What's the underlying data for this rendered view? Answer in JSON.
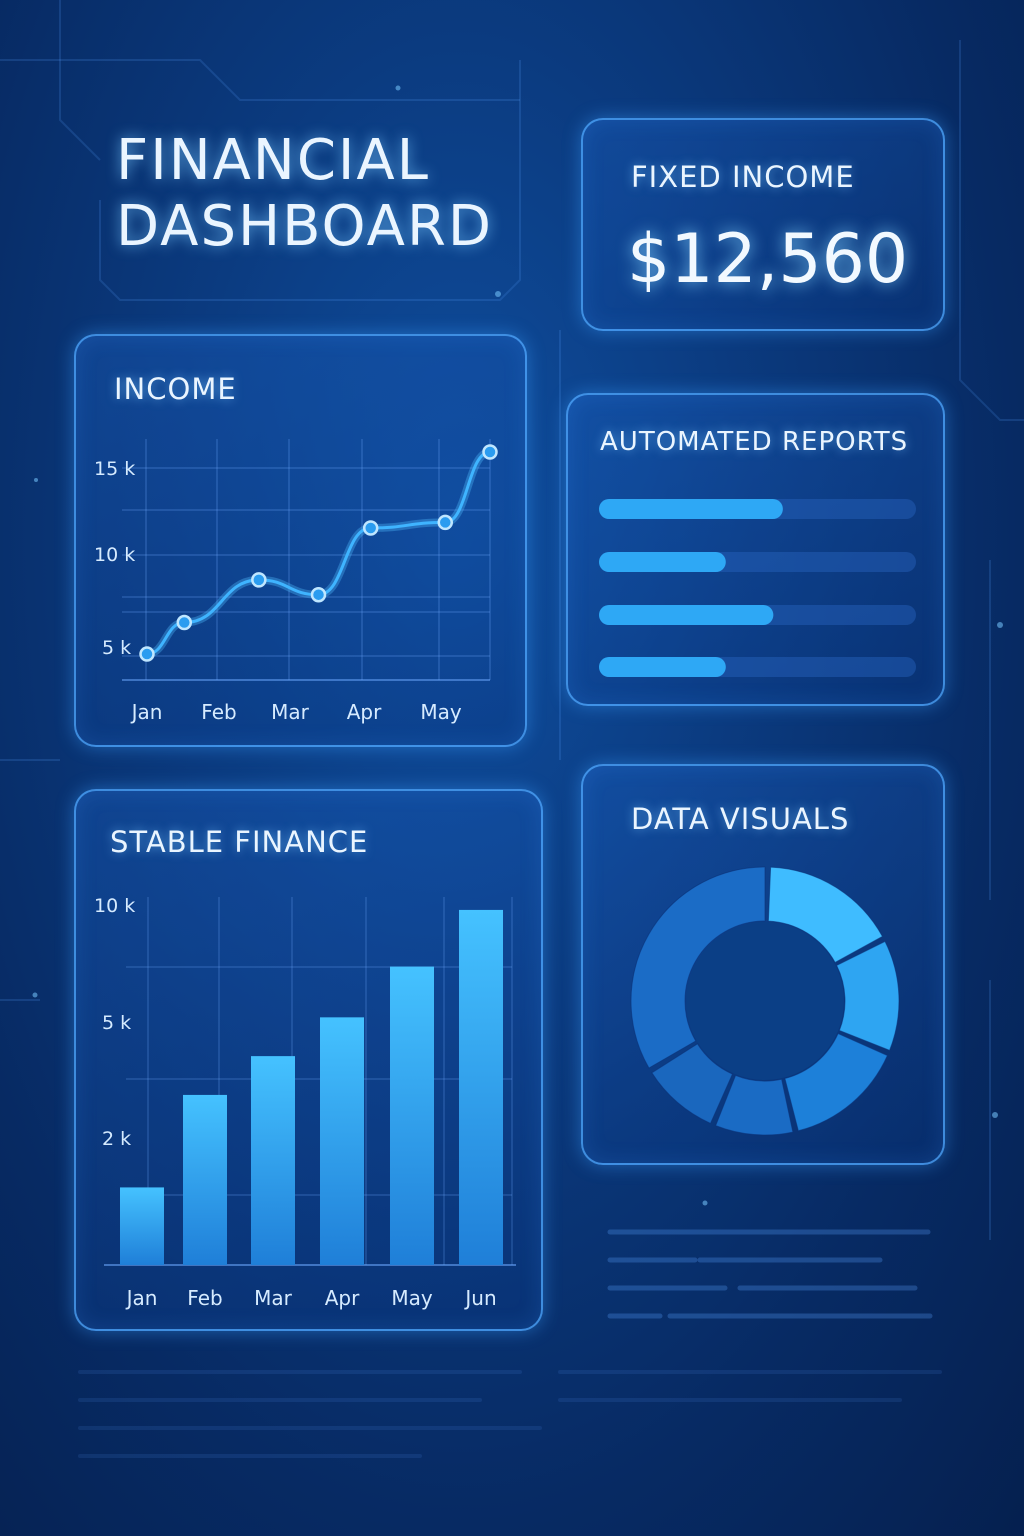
{
  "page": {
    "title_line1": "FINANCIAL",
    "title_line2": "DASHBOARD"
  },
  "fixed_income": {
    "label": "FIXED INCOME",
    "value": "$12,560"
  },
  "automated_reports": {
    "label": "AUTOMATED REPORTS",
    "progress": [
      0.58,
      0.4,
      0.55,
      0.4
    ]
  },
  "data_visuals": {
    "label": "DATA VISUALS"
  },
  "colors": {
    "accent": "#3fb4ff",
    "panel_border": "#50aaff",
    "background": "#0b3b80"
  },
  "chart_data": [
    {
      "type": "line",
      "title": "INCOME",
      "x": [
        "Jan",
        "",
        "Feb",
        "",
        "Mar",
        "",
        "Apr",
        "",
        "May",
        ""
      ],
      "xlabels": [
        "Jan",
        "Feb",
        "Mar",
        "Apr",
        "May"
      ],
      "ytick_labels": [
        "15 k",
        "10 k",
        "5 k"
      ],
      "ytick_values": [
        15,
        10,
        5
      ],
      "points": [
        {
          "x": 0.0,
          "y": 4.4
        },
        {
          "x": 0.5,
          "y": 6.1
        },
        {
          "x": 1.5,
          "y": 8.4
        },
        {
          "x": 2.3,
          "y": 7.6
        },
        {
          "x": 3.0,
          "y": 11.2
        },
        {
          "x": 4.0,
          "y": 11.5
        },
        {
          "x": 4.6,
          "y": 15.3
        }
      ],
      "ylim": [
        3.0,
        16.0
      ],
      "grid": true
    },
    {
      "type": "bar",
      "title": "STABLE FINANCE",
      "categories": [
        "Jan",
        "Feb",
        "Mar",
        "Apr",
        "May",
        "Jun"
      ],
      "values": [
        1.3,
        2.85,
        3.5,
        4.15,
        5.0,
        5.95
      ],
      "ytick_labels": [
        "10 k",
        "5 k",
        "2 k"
      ],
      "ylim": [
        0,
        6.2
      ],
      "grid": true
    },
    {
      "type": "pie",
      "title": "DATA VISUALS",
      "slices": [
        {
          "value": 17,
          "color": "#3fbcff"
        },
        {
          "value": 14,
          "color": "#2ea5f2"
        },
        {
          "value": 15,
          "color": "#1d80d9"
        },
        {
          "value": 10,
          "color": "#1a6bc4"
        },
        {
          "value": 10,
          "color": "#1a67be"
        },
        {
          "value": 34,
          "color": "#1b6cc6"
        }
      ],
      "donut": true
    }
  ]
}
